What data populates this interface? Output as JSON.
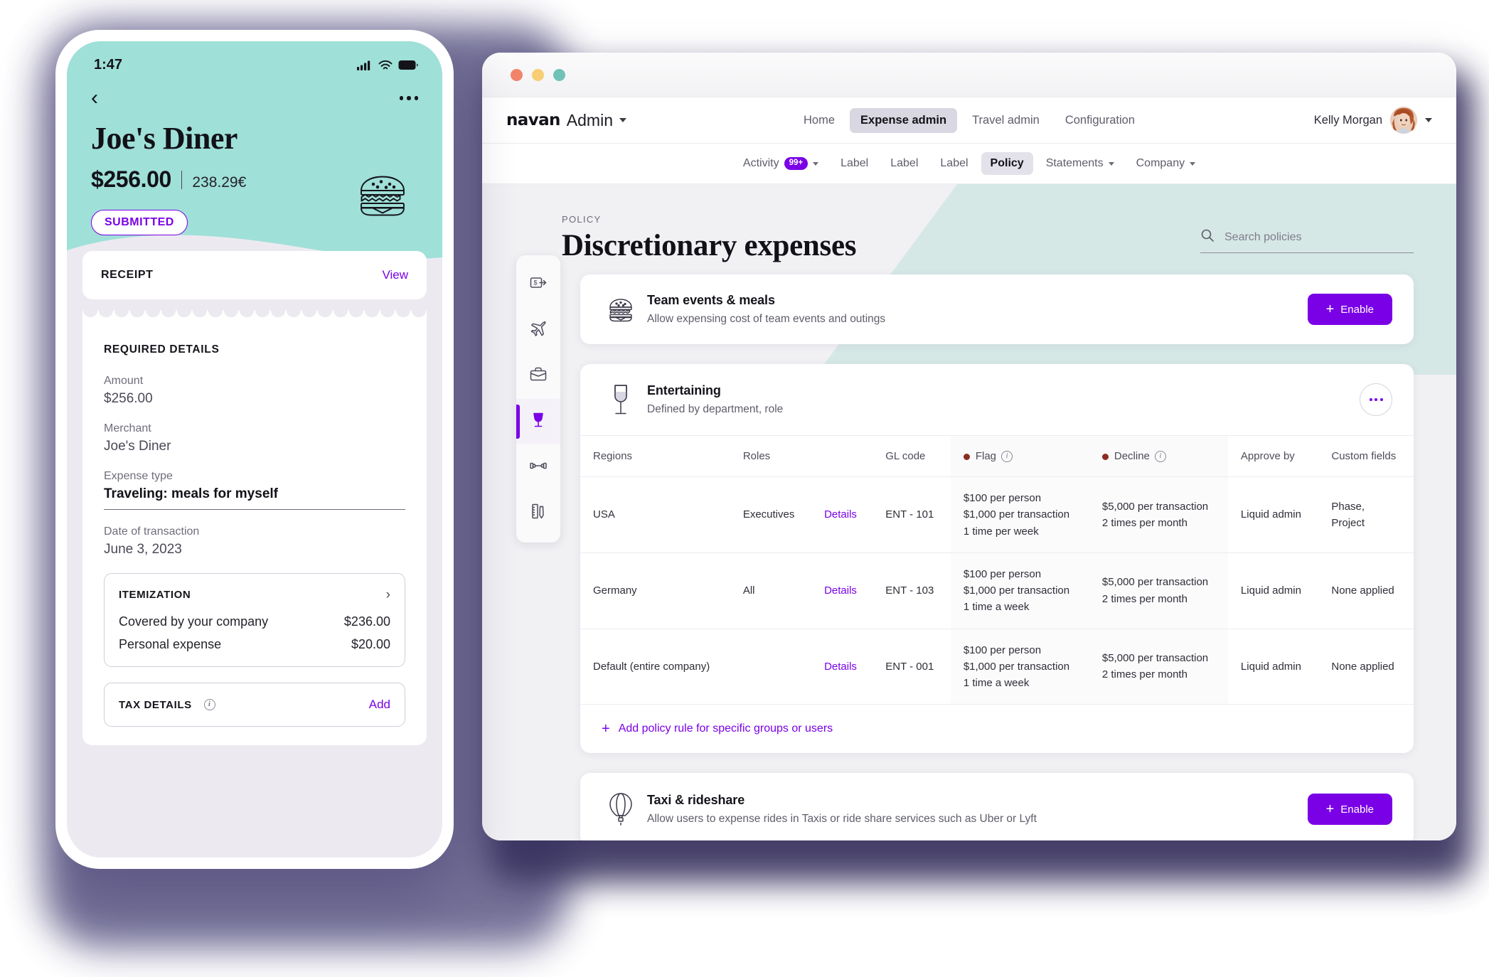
{
  "phone": {
    "status_bar": {
      "time": "1:47"
    },
    "nav": {
      "back_icon": "chevron-left-icon",
      "more_icon": "ellipsis-icon"
    },
    "merchant_name": "Joe's Diner",
    "amount_primary": "$256.00",
    "amount_secondary": "238.29€",
    "status_badge": "SUBMITTED",
    "header_icon": "burger-icon",
    "receipt_card": {
      "title": "RECEIPT",
      "action": "View"
    },
    "required_details": {
      "section_title": "REQUIRED DETAILS",
      "fields": [
        {
          "label": "Amount",
          "value": "$256.00"
        },
        {
          "label": "Merchant",
          "value": "Joe's Diner"
        },
        {
          "label": "Expense type",
          "value": "Traveling: meals for myself"
        },
        {
          "label": "Date of transaction",
          "value": "June 3, 2023"
        }
      ]
    },
    "itemization": {
      "title": "ITEMIZATION",
      "chevron_icon": "chevron-right-icon",
      "rows": [
        {
          "label": "Covered by your company",
          "value": "$236.00"
        },
        {
          "label": "Personal expense",
          "value": "$20.00"
        }
      ]
    },
    "tax_details": {
      "title": "TAX DETAILS",
      "info_icon": "info-icon",
      "action": "Add"
    }
  },
  "desktop": {
    "window_controls": [
      "close",
      "minimize",
      "maximize"
    ],
    "brand": {
      "name": "navan",
      "suffix": "Admin",
      "caret_icon": "caret-down-icon"
    },
    "top_nav": [
      {
        "label": "Home",
        "active": false
      },
      {
        "label": "Expense admin",
        "active": true
      },
      {
        "label": "Travel admin",
        "active": false
      },
      {
        "label": "Configuration",
        "active": false
      }
    ],
    "user": {
      "name": "Kelly Morgan",
      "avatar_icon": "avatar",
      "caret_icon": "caret-down-icon"
    },
    "sub_nav": [
      {
        "label": "Activity",
        "badge": "99+",
        "caret": true,
        "active": false
      },
      {
        "label": "Label",
        "active": false
      },
      {
        "label": "Label",
        "active": false
      },
      {
        "label": "Label",
        "active": false
      },
      {
        "label": "Policy",
        "active": true
      },
      {
        "label": "Statements",
        "caret": true,
        "active": false
      },
      {
        "label": "Company",
        "caret": true,
        "active": false
      }
    ],
    "page": {
      "eyebrow": "POLICY",
      "title": "Discretionary expenses"
    },
    "search": {
      "placeholder": "Search policies",
      "value": "",
      "icon": "search-icon"
    },
    "rail": [
      {
        "icon": "money-transfer-icon",
        "active": false
      },
      {
        "icon": "airplane-icon",
        "active": false
      },
      {
        "icon": "briefcase-icon",
        "active": false
      },
      {
        "icon": "wine-glass-icon",
        "active": true
      },
      {
        "icon": "dumbbell-icon",
        "active": false
      },
      {
        "icon": "ruler-pen-icon",
        "active": false
      }
    ],
    "cards": {
      "team_events": {
        "icon": "burger-icon",
        "title": "Team events & meals",
        "subtitle": "Allow expensing cost of team events and outings",
        "button": "Enable",
        "button_icon": "plus-icon"
      },
      "entertaining": {
        "icon": "wine-glass-icon",
        "title": "Entertaining",
        "subtitle": "Defined by department, role",
        "menu_icon": "ellipsis-icon"
      },
      "taxi": {
        "icon": "hot-air-balloon-icon",
        "title": "Taxi & rideshare",
        "subtitle": "Allow users to expense rides in Taxis or ride share services such as Uber or Lyft",
        "button": "Enable",
        "button_icon": "plus-icon"
      }
    },
    "table": {
      "headers": [
        {
          "label": "Regions"
        },
        {
          "label": "Roles"
        },
        {
          "label": ""
        },
        {
          "label": "GL code"
        },
        {
          "label": "Flag",
          "dot": "#8c2d20",
          "info": true
        },
        {
          "label": "Decline",
          "dot": "#8c2d20",
          "info": true
        },
        {
          "label": "Approve by"
        },
        {
          "label": "Custom fields"
        }
      ],
      "rows": [
        {
          "region": "USA",
          "role": "Executives",
          "details": "Details",
          "gl_code": "ENT - 101",
          "flag": "$100 per person\n$1,000 per transaction\n1 time per week",
          "decline": "$5,000 per transaction\n2 times per month",
          "approve_by": "Liquid admin",
          "custom_fields": "Phase,\nProject",
          "custom_muted": false,
          "region_muted": false
        },
        {
          "region": "Germany",
          "role": "All",
          "details": "Details",
          "gl_code": "ENT - 103",
          "flag": "$100 per person\n$1,000 per transaction\n1 time a week",
          "decline": "$5,000 per transaction\n2 times per month",
          "approve_by": "Liquid admin",
          "custom_fields": "None applied",
          "custom_muted": true,
          "region_muted": false
        },
        {
          "region": "Default (entire company)",
          "role": "",
          "details": "Details",
          "gl_code": "ENT - 001",
          "flag": "$100 per person\n$1,000 per transaction\n1 time a week",
          "decline": "$5,000 per transaction\n2 times per month",
          "approve_by": "Liquid admin",
          "custom_fields": "None applied",
          "custom_muted": true,
          "region_muted": true
        }
      ],
      "add_rule": {
        "label": "Add policy rule for specific groups or users",
        "icon": "plus-icon"
      }
    }
  },
  "colors": {
    "accent_purple": "#7a00e6",
    "teal_header": "#9fe0d8",
    "teal_shape": "#d6e8e6",
    "page_bg": "#f1f0f3",
    "flag_dot": "#8c2d20",
    "shadow_purple": "#6e6a93"
  }
}
